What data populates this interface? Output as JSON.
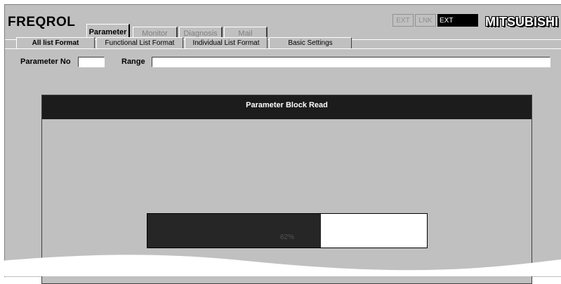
{
  "app": {
    "title": "FREQROL",
    "brand": "MITSUBISHI"
  },
  "main_tabs": [
    {
      "label": "Parameter",
      "active": true
    },
    {
      "label": "Monitor",
      "active": false
    },
    {
      "label": "Diagnosis",
      "active": false
    },
    {
      "label": "Mail",
      "active": false
    }
  ],
  "indicators": [
    {
      "label": "EXT",
      "lit": false
    },
    {
      "label": "LNK",
      "lit": false
    },
    {
      "label": "EXT",
      "lit": true
    }
  ],
  "sub_tabs": [
    {
      "label": "All list Format",
      "active": true
    },
    {
      "label": "Functional List Format",
      "active": false
    },
    {
      "label": "Individual List Format",
      "active": false
    },
    {
      "label": "Basic Settings",
      "active": false
    }
  ],
  "fields": {
    "parameter_no_label": "Parameter No",
    "parameter_no_value": "",
    "range_label": "Range",
    "range_value": ""
  },
  "dialog": {
    "title": "Parameter Block Read",
    "progress_text": "62%",
    "progress_value": 0.62
  },
  "colors": {
    "window_bg": "#c0c0c0",
    "title_bar": "#1c1c1c",
    "progress_fill": "#262626"
  }
}
